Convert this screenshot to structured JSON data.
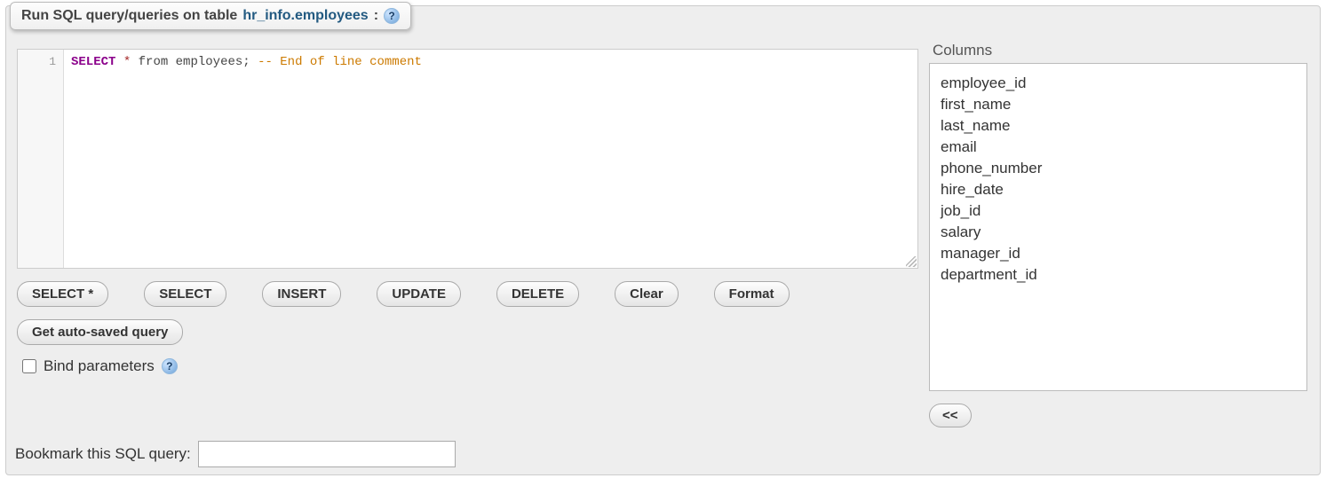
{
  "header": {
    "prefix": "Run SQL query/queries on table ",
    "tableref": "hr_info.employees",
    "suffix": ":"
  },
  "editor": {
    "line_number": "1",
    "tokens": {
      "select": "SELECT",
      "star": "*",
      "from": "from",
      "tbl": "employees;",
      "comment": "-- End of line comment"
    }
  },
  "buttons": {
    "select_star": "SELECT *",
    "select": "SELECT",
    "insert": "INSERT",
    "update": "UPDATE",
    "delete": "DELETE",
    "clear": "Clear",
    "format": "Format",
    "autosaved": "Get auto-saved query",
    "collapse": "<<"
  },
  "bind_label": "Bind parameters",
  "bookmark_label": "Bookmark this SQL query:",
  "bookmark_value": "",
  "columns_title": "Columns",
  "columns": [
    "employee_id",
    "first_name",
    "last_name",
    "email",
    "phone_number",
    "hire_date",
    "job_id",
    "salary",
    "manager_id",
    "department_id"
  ]
}
